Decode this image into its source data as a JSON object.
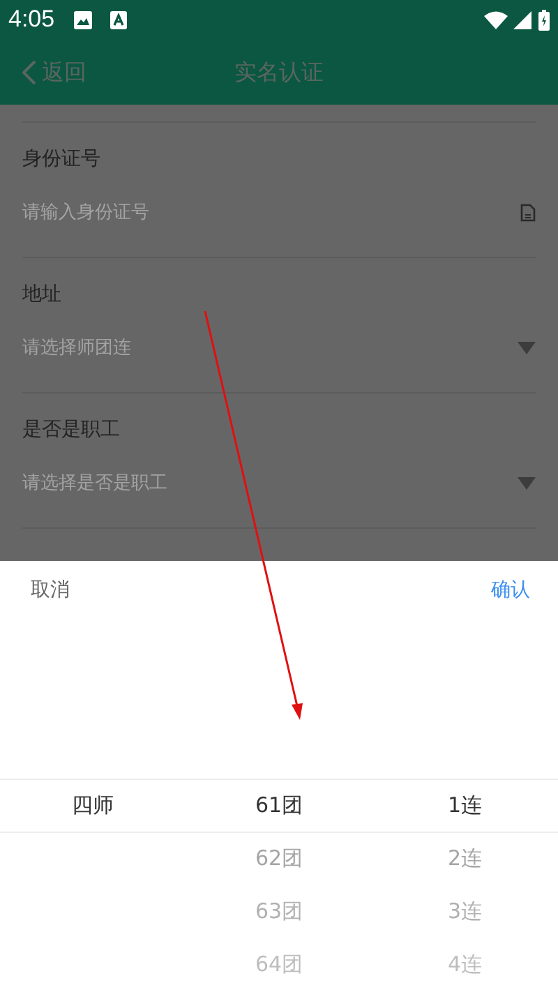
{
  "status_bar": {
    "time": "4:05"
  },
  "header": {
    "back": "返回",
    "title": "实名认证"
  },
  "fields": [
    {
      "label": "身份证号",
      "placeholder": "请输入身份证号",
      "kind": "input"
    },
    {
      "label": "地址",
      "placeholder": "请选择师团连",
      "kind": "select"
    },
    {
      "label": "是否是职工",
      "placeholder": "请选择是否是职工",
      "kind": "select"
    }
  ],
  "picker": {
    "cancel": "取消",
    "confirm": "确认",
    "columns": [
      {
        "items": [
          {
            "label": "四师",
            "selected": true
          }
        ]
      },
      {
        "items": [
          {
            "label": "61团",
            "selected": true
          },
          {
            "label": "62团",
            "selected": false
          },
          {
            "label": "63团",
            "selected": false
          },
          {
            "label": "64团",
            "selected": false
          }
        ]
      },
      {
        "items": [
          {
            "label": "1连",
            "selected": true
          },
          {
            "label": "2连",
            "selected": false
          },
          {
            "label": "3连",
            "selected": false
          },
          {
            "label": "4连",
            "selected": false
          }
        ]
      }
    ]
  }
}
